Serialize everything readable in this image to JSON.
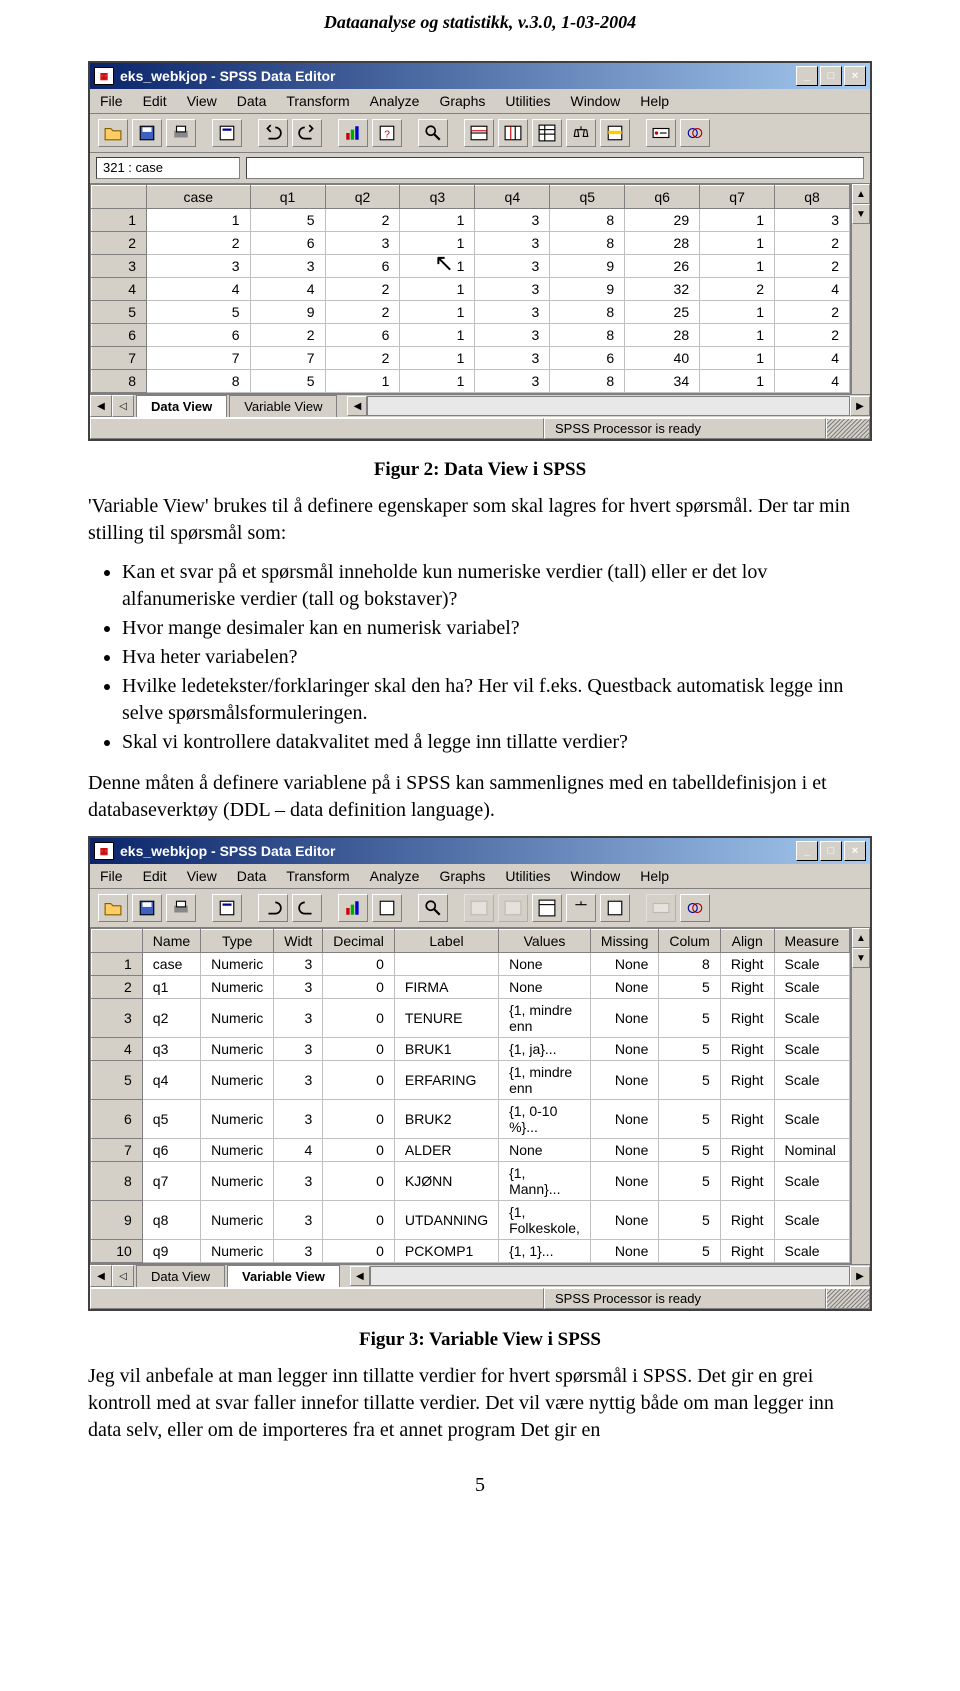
{
  "header": "Dataanalyse og statistikk, v.3.0, 1-03-2004",
  "win": {
    "title": "eks_webkjop - SPSS Data Editor",
    "minimize": "_",
    "maximize": "□",
    "close": "×",
    "cellref": "321 : case",
    "status": "SPSS Processor  is ready"
  },
  "menu": [
    "File",
    "Edit",
    "View",
    "Data",
    "Transform",
    "Analyze",
    "Graphs",
    "Utilities",
    "Window",
    "Help"
  ],
  "tabs": {
    "data": "Data View",
    "var": "Variable View"
  },
  "grid1": {
    "cols": [
      "case",
      "q1",
      "q2",
      "q3",
      "q4",
      "q5",
      "q6",
      "q7",
      "q8"
    ],
    "rows": [
      [
        "1",
        "1",
        "5",
        "2",
        "1",
        "3",
        "8",
        "29",
        "1",
        "3"
      ],
      [
        "2",
        "2",
        "6",
        "3",
        "1",
        "3",
        "8",
        "28",
        "1",
        "2"
      ],
      [
        "3",
        "3",
        "3",
        "6",
        "1",
        "3",
        "9",
        "26",
        "1",
        "2"
      ],
      [
        "4",
        "4",
        "4",
        "2",
        "1",
        "3",
        "9",
        "32",
        "2",
        "4"
      ],
      [
        "5",
        "5",
        "9",
        "2",
        "1",
        "3",
        "8",
        "25",
        "1",
        "2"
      ],
      [
        "6",
        "6",
        "2",
        "6",
        "1",
        "3",
        "8",
        "28",
        "1",
        "2"
      ],
      [
        "7",
        "7",
        "7",
        "2",
        "1",
        "3",
        "6",
        "40",
        "1",
        "4"
      ],
      [
        "8",
        "8",
        "5",
        "1",
        "1",
        "3",
        "8",
        "34",
        "1",
        "4"
      ]
    ]
  },
  "caption1": "Figur 2: Data View i SPSS",
  "para1": "'Variable View' brukes til å definere egenskaper som skal lagres for hvert spørsmål. Der tar min stilling til spørsmål som:",
  "bullets": [
    "Kan et svar på et spørsmål inneholde kun numeriske verdier (tall) eller er det lov alfanumeriske verdier (tall og bokstaver)?",
    "Hvor mange desimaler kan en numerisk variabel?",
    "Hva heter variabelen?",
    "Hvilke ledetekster/forklaringer skal den ha? Her vil f.eks. Questback automatisk legge inn selve spørsmålsformuleringen.",
    "Skal vi kontrollere datakvalitet med å legge inn tillatte verdier?"
  ],
  "para2": "Denne måten å definere variablene på i SPSS kan sammenlignes med en tabelldefinisjon i et databaseverktøy (DDL – data definition language).",
  "grid2": {
    "cols": [
      "Name",
      "Type",
      "Widt",
      "Decimal",
      "Label",
      "Values",
      "Missing",
      "Colum",
      "Align",
      "Measure"
    ],
    "rows": [
      [
        "1",
        "case",
        "Numeric",
        "3",
        "0",
        "",
        "None",
        "None",
        "8",
        "Right",
        "Scale"
      ],
      [
        "2",
        "q1",
        "Numeric",
        "3",
        "0",
        "FIRMA",
        "None",
        "None",
        "5",
        "Right",
        "Scale"
      ],
      [
        "3",
        "q2",
        "Numeric",
        "3",
        "0",
        "TENURE",
        "{1, mindre enn",
        "None",
        "5",
        "Right",
        "Scale"
      ],
      [
        "4",
        "q3",
        "Numeric",
        "3",
        "0",
        "BRUK1",
        "{1, ja}...",
        "None",
        "5",
        "Right",
        "Scale"
      ],
      [
        "5",
        "q4",
        "Numeric",
        "3",
        "0",
        "ERFARING",
        "{1, mindre enn",
        "None",
        "5",
        "Right",
        "Scale"
      ],
      [
        "6",
        "q5",
        "Numeric",
        "3",
        "0",
        "BRUK2",
        "{1, 0-10 %}...",
        "None",
        "5",
        "Right",
        "Scale"
      ],
      [
        "7",
        "q6",
        "Numeric",
        "4",
        "0",
        "ALDER",
        "None",
        "None",
        "5",
        "Right",
        "Nominal"
      ],
      [
        "8",
        "q7",
        "Numeric",
        "3",
        "0",
        "KJØNN",
        "{1, Mann}...",
        "None",
        "5",
        "Right",
        "Scale"
      ],
      [
        "9",
        "q8",
        "Numeric",
        "3",
        "0",
        "UTDANNING",
        "{1, Folkeskole,",
        "None",
        "5",
        "Right",
        "Scale"
      ],
      [
        "10",
        "q9",
        "Numeric",
        "3",
        "0",
        "PCKOMP1",
        "{1, 1}...",
        "None",
        "5",
        "Right",
        "Scale"
      ]
    ]
  },
  "caption2": "Figur 3: Variable View i SPSS",
  "para3": "Jeg vil anbefale at man legger inn tillatte verdier for hvert spørsmål i SPSS. Det gir en grei kontroll med at svar faller innefor tillatte verdier. Det vil være nyttig både om man legger inn data selv, eller om de importeres fra et annet program Det gir en",
  "pagenum": "5",
  "icons": {
    "open": "open",
    "save": "save",
    "print": "print",
    "look": "look",
    "undo": "undo",
    "redo": "redo",
    "chart": "chart",
    "help": "help",
    "find": "find",
    "cases": "cases",
    "vars": "vars",
    "grid": "grid",
    "labels": "labels",
    "scale": "scale",
    "weight": "weight",
    "select": "select",
    "star": "star"
  }
}
